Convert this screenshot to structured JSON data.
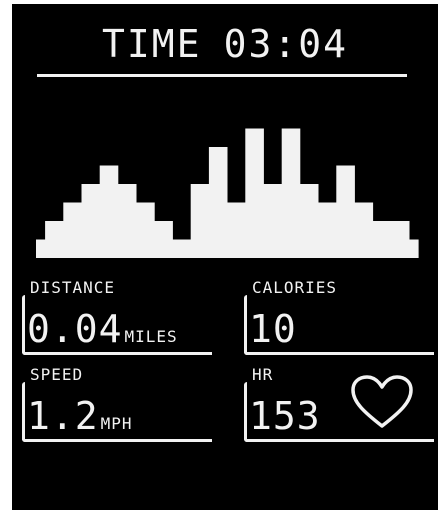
{
  "header": {
    "time_label": "TIME",
    "time_value": "03:04"
  },
  "stats": {
    "distance": {
      "label": "DISTANCE",
      "value": "0.04",
      "unit": "MILES"
    },
    "calories": {
      "label": "CALORIES",
      "value": "10"
    },
    "speed": {
      "label": "SPEED",
      "value": "1.2",
      "unit": "MPH"
    },
    "hr": {
      "label": "HR",
      "value": "153",
      "icon": "heart-icon"
    }
  },
  "chart_data": {
    "type": "bar",
    "values": [
      1,
      2,
      2,
      3,
      3,
      4,
      4,
      5,
      5,
      4,
      4,
      3,
      3,
      2,
      2,
      1,
      1,
      4,
      4,
      6,
      6,
      3,
      3,
      7,
      7,
      4,
      4,
      7,
      7,
      4,
      4,
      3,
      3,
      5,
      5,
      3,
      3,
      2,
      2,
      2,
      2,
      1
    ],
    "ylim": [
      0,
      8
    ]
  },
  "colors": {
    "screen": "#000000",
    "lcd": "#f2f2f2"
  }
}
